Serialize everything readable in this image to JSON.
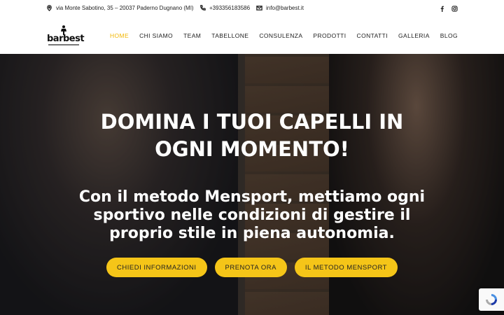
{
  "topbar": {
    "address": "via Monte Sabotino, 35 – 20037 Paderno Dugnano (MI)",
    "phone": "+393356183586",
    "email": "info@barbest.it"
  },
  "brand": {
    "logo_text": "barbest"
  },
  "nav": {
    "items": [
      {
        "label": "HOME",
        "active": true
      },
      {
        "label": "CHI SIAMO"
      },
      {
        "label": "TEAM"
      },
      {
        "label": "TABELLONE"
      },
      {
        "label": "CONSULENZA"
      },
      {
        "label": "PRODOTTI"
      },
      {
        "label": "CONTATTI"
      },
      {
        "label": "GALLERIA"
      },
      {
        "label": "BLOG"
      }
    ]
  },
  "hero": {
    "title_line1": "DOMINA I TUOI CAPELLI IN",
    "title_line2": "OGNI MOMENTO!",
    "subtitle": "Con il metodo Mensport, mettiamo ogni sportivo nelle condizioni di gestire il proprio stile in piena autonomia.",
    "cta": [
      {
        "label": "CHIEDI INFORMAZIONI"
      },
      {
        "label": "PRENOTA ORA"
      },
      {
        "label": "IL METODO MENSPORT"
      }
    ]
  },
  "colors": {
    "accent": "#f5c518",
    "nav_active": "#f2b705"
  },
  "icons": [
    "location-icon",
    "phone-icon",
    "email-icon",
    "facebook-icon",
    "instagram-icon",
    "recaptcha-icon"
  ]
}
